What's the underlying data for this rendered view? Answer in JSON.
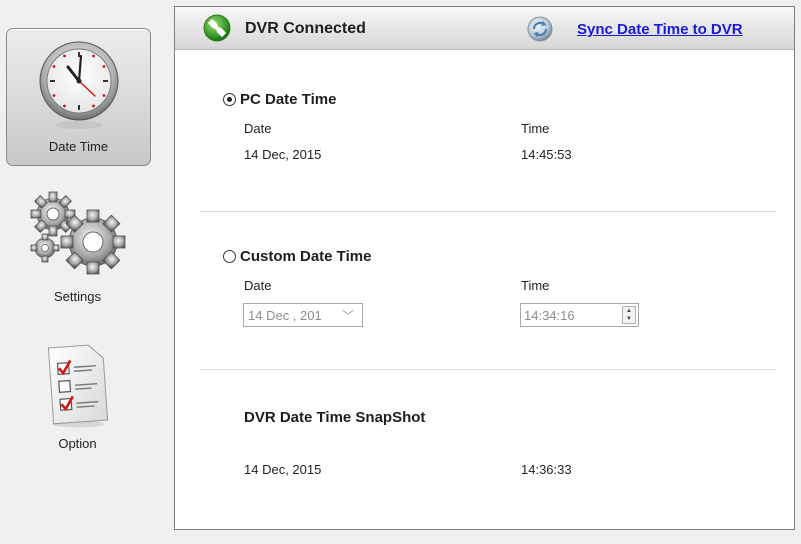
{
  "sidebar": {
    "items": [
      {
        "label": "Date Time",
        "icon": "clock-icon"
      },
      {
        "label": "Settings",
        "icon": "gears-icon"
      },
      {
        "label": "Option",
        "icon": "checklist-icon"
      }
    ]
  },
  "header": {
    "status": "DVR Connected",
    "sync_link": "Sync Date Time to DVR"
  },
  "pc_section": {
    "title": "PC Date Time",
    "selected": true,
    "date_label": "Date",
    "time_label": "Time",
    "date_value": "14 Dec, 2015",
    "time_value": "14:45:53"
  },
  "custom_section": {
    "title": "Custom Date Time",
    "selected": false,
    "date_label": "Date",
    "time_label": "Time",
    "date_value": "14 Dec , 201",
    "time_value": "14:34:16"
  },
  "snapshot_section": {
    "title": "DVR Date Time SnapShot",
    "date_value": "14 Dec, 2015",
    "time_value": "14:36:33"
  },
  "colors": {
    "link": "#1a1adb",
    "connected_green": "#3a9b27"
  }
}
